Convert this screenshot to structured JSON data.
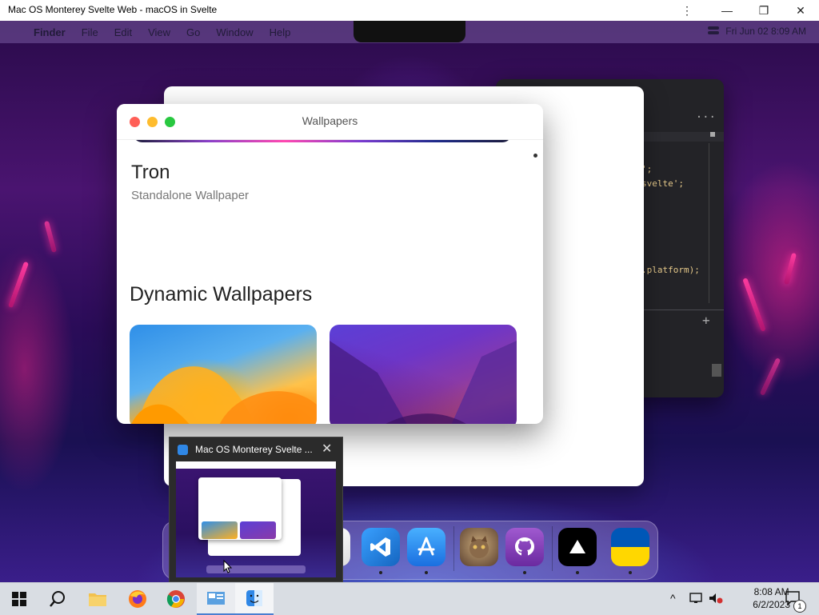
{
  "browser": {
    "title": "Mac OS Monterey Svelte Web - macOS in Svelte",
    "controls": {
      "menu": "⋮",
      "minimize": "—",
      "restore": "❐",
      "close": "✕"
    }
  },
  "menubar": {
    "apple": "",
    "items": [
      "Finder",
      "File",
      "Edit",
      "View",
      "Go",
      "Window",
      "Help"
    ],
    "datetime": "Fri Jun 02  8:09 AM"
  },
  "editor": {
    "lines": [
      "';",
      "svelte';",
      ".platform);"
    ],
    "more": "...",
    "plus": "+"
  },
  "wallpapers_window": {
    "title": "Wallpapers",
    "current_name": "Tron",
    "current_type": "Standalone Wallpaper",
    "section_heading": "Dynamic Wallpapers"
  },
  "preview": {
    "title": "Mac OS Monterey Svelte ...",
    "close": "✕"
  },
  "taskbar": {
    "time": "8:08 AM",
    "date": "6/2/2023",
    "notification_count": "1"
  },
  "colors": {
    "traffic_red": "#ff5f57",
    "traffic_yellow": "#febc2e",
    "traffic_green": "#28c840",
    "taskbar_bg": "#d9dde3"
  }
}
